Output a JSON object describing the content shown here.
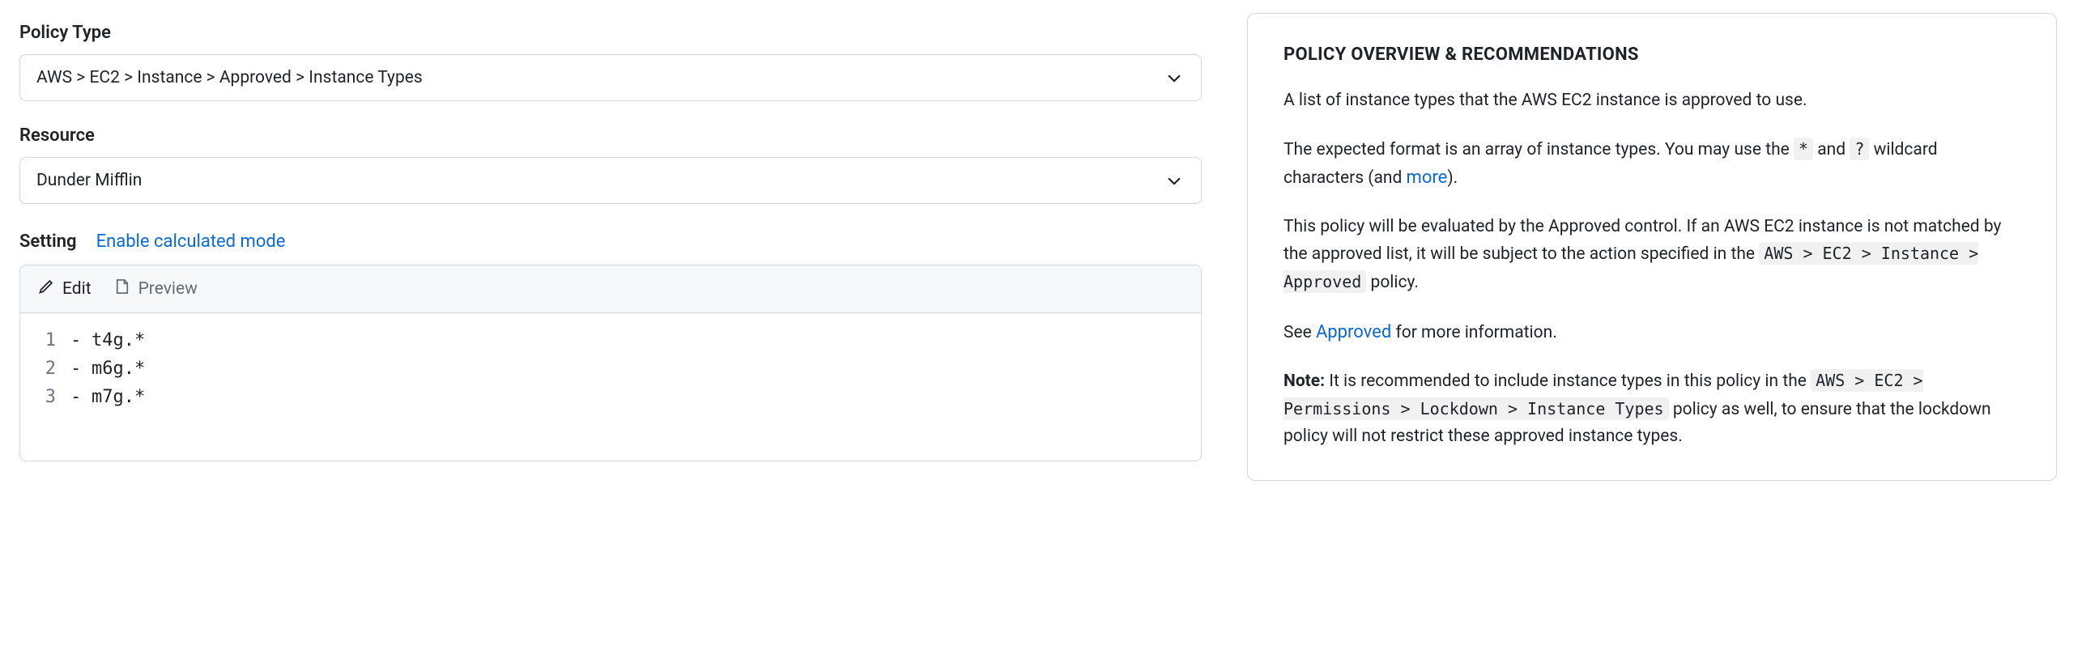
{
  "form": {
    "policy_type_label": "Policy Type",
    "policy_type_value": "AWS > EC2 > Instance > Approved > Instance Types",
    "resource_label": "Resource",
    "resource_value": "Dunder Mifflin",
    "setting_label": "Setting",
    "calc_link": "Enable calculated mode",
    "tabs": {
      "edit": "Edit",
      "preview": "Preview"
    },
    "code_lines": [
      "t4g.*",
      "m6g.*",
      "m7g.*"
    ]
  },
  "overview": {
    "heading": "POLICY OVERVIEW & RECOMMENDATIONS",
    "p1": "A list of instance types that the AWS EC2 instance is approved to use.",
    "p2_a": "The expected format is an array of instance types. You may use the ",
    "p2_code1": "*",
    "p2_b": " and ",
    "p2_code2": "?",
    "p2_c": " wildcard characters (and ",
    "p2_link": "more",
    "p2_d": ").",
    "p3_a": "This policy will be evaluated by the Approved control. If an AWS EC2 instance is not matched by the approved list, it will be subject to the action specified in the ",
    "p3_code": "AWS > EC2 > Instance > Approved",
    "p3_b": " policy.",
    "p4_a": "See ",
    "p4_link": "Approved",
    "p4_b": " for more information.",
    "p5_strong": "Note:",
    "p5_a": " It is recommended to include instance types in this policy in the ",
    "p5_code": "AWS > EC2 > Permissions > Lockdown > Instance Types",
    "p5_b": " policy as well, to ensure that the lockdown policy will not restrict these approved instance types."
  }
}
